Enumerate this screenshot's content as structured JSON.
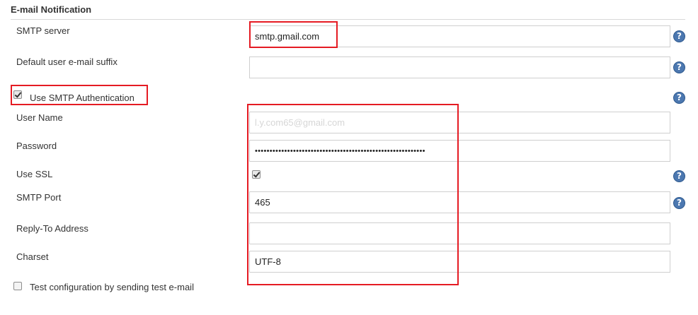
{
  "section": {
    "title": "E-mail Notification"
  },
  "fields": {
    "smtp_server": {
      "label": "SMTP server",
      "value": "smtp.gmail.com"
    },
    "default_suffix": {
      "label": "Default user e-mail suffix",
      "value": ""
    },
    "use_smtp_auth": {
      "label": "Use SMTP Authentication",
      "checked": true
    },
    "user_name": {
      "label": "User Name",
      "value": "l.y.com65@gmail.com"
    },
    "password": {
      "label": "Password",
      "value": "••••••••••••••••••••••••••••••••••••••••••••••••••••••••••"
    },
    "use_ssl": {
      "label": "Use SSL",
      "checked": true
    },
    "smtp_port": {
      "label": "SMTP Port",
      "value": "465"
    },
    "reply_to": {
      "label": "Reply-To Address",
      "value": ""
    },
    "charset": {
      "label": "Charset",
      "value": "UTF-8"
    },
    "test_config": {
      "label": "Test configuration by sending test e-mail",
      "checked": false
    }
  },
  "icons": {
    "help": "question-mark-circle-icon",
    "help_glyph": "?"
  },
  "colors": {
    "highlight": "#e51b23",
    "help_icon": "#4c78b0"
  }
}
